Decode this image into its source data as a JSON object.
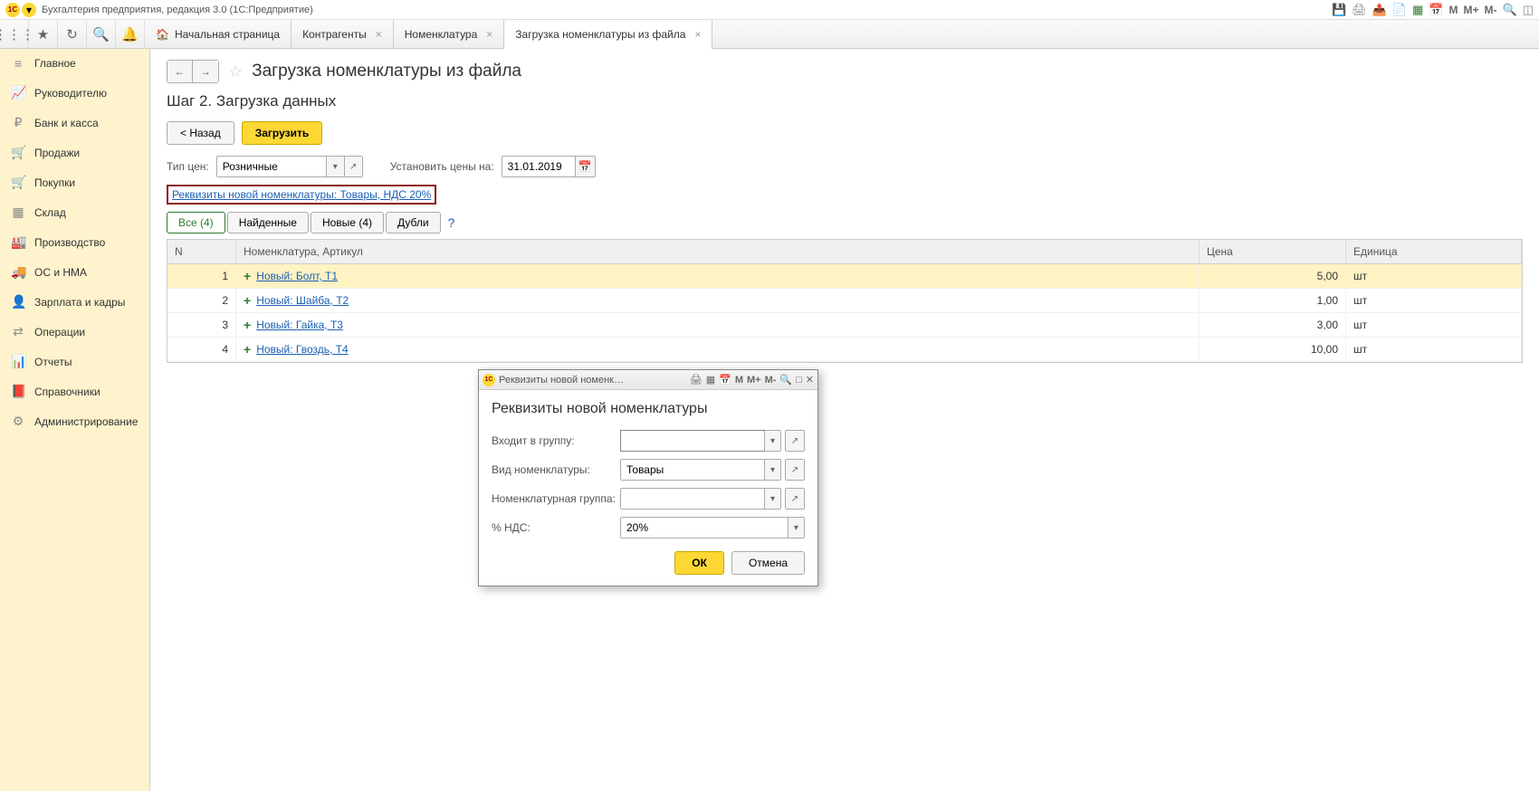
{
  "app_title": "Бухгалтерия предприятия, редакция 3.0  (1С:Предприятие)",
  "tabs": {
    "home": "Начальная страница",
    "t1": "Контрагенты",
    "t2": "Номенклатура",
    "t3": "Загрузка номенклатуры из файла"
  },
  "sidebar": [
    {
      "icon": "≡",
      "label": "Главное"
    },
    {
      "icon": "📈",
      "label": "Руководителю"
    },
    {
      "icon": "₽",
      "label": "Банк и касса"
    },
    {
      "icon": "🛒",
      "label": "Продажи"
    },
    {
      "icon": "🛒",
      "label": "Покупки"
    },
    {
      "icon": "▦",
      "label": "Склад"
    },
    {
      "icon": "🏭",
      "label": "Производство"
    },
    {
      "icon": "🚚",
      "label": "ОС и НМА"
    },
    {
      "icon": "👤",
      "label": "Зарплата и кадры"
    },
    {
      "icon": "⇄",
      "label": "Операции"
    },
    {
      "icon": "📊",
      "label": "Отчеты"
    },
    {
      "icon": "📕",
      "label": "Справочники"
    },
    {
      "icon": "⚙",
      "label": "Администрирование"
    }
  ],
  "page": {
    "title": "Загрузка номенклатуры из файла",
    "step": "Шаг 2. Загрузка данных",
    "back": "< Назад",
    "load": "Загрузить",
    "price_type_label": "Тип цен:",
    "price_type_value": "Розничные",
    "set_prices_label": "Установить цены на:",
    "date_value": "31.01.2019",
    "req_link": "Реквизиты новой номенклатуры: Товары, НДС 20%",
    "filter_tabs": {
      "all": "Все (4)",
      "found": "Найденные",
      "new": "Новые (4)",
      "dupes": "Дубли"
    },
    "grid_headers": {
      "n": "N",
      "nom": "Номенклатура, Артикул",
      "price": "Цена",
      "unit": "Единица"
    },
    "rows": [
      {
        "n": "1",
        "nom": "Новый: Болт, Т1",
        "price": "5,00",
        "unit": "шт"
      },
      {
        "n": "2",
        "nom": "Новый: Шайба, Т2",
        "price": "1,00",
        "unit": "шт"
      },
      {
        "n": "3",
        "nom": "Новый: Гайка, Т3",
        "price": "3,00",
        "unit": "шт"
      },
      {
        "n": "4",
        "nom": "Новый: Гвоздь, Т4",
        "price": "10,00",
        "unit": "шт"
      }
    ]
  },
  "dialog": {
    "titlebar": "Реквизиты новой номенклат...",
    "heading": "Реквизиты новой номенклатуры",
    "fields": {
      "group_label": "Входит в группу:",
      "group_value": "",
      "kind_label": "Вид номенклатуры:",
      "kind_value": "Товары",
      "nomgroup_label": "Номенклатурная группа:",
      "nomgroup_value": "",
      "vat_label": "% НДС:",
      "vat_value": "20%"
    },
    "ok": "ОК",
    "cancel": "Отмена"
  },
  "memory_labels": {
    "m": "M",
    "mp": "M+",
    "mm": "M-"
  }
}
